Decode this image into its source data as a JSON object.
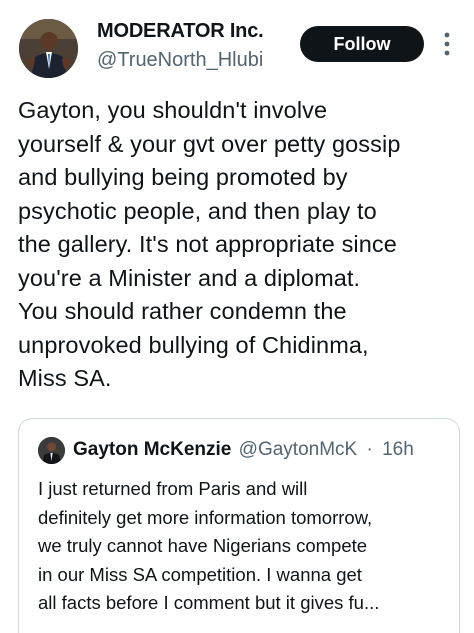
{
  "tweet": {
    "author": {
      "display_name": "MODERATOR Inc.",
      "handle": "@TrueNorth_Hlubi",
      "avatar_icon": "profile-photo"
    },
    "follow_label": "Follow",
    "more_icon": "vertical-ellipsis-icon",
    "body_lines": [
      "Gayton, you shouldn't involve",
      "yourself & your gvt over petty gossip",
      "and bullying being promoted by",
      "psychotic people, and then play to",
      "the gallery. It's not appropriate since",
      "you're a Minister and a diplomat.",
      "You should rather condemn the",
      "unprovoked bullying of Chidinma,",
      "Miss SA."
    ]
  },
  "quoted_tweet": {
    "author": {
      "display_name": "Gayton McKenzie",
      "handle": "@GaytonMcK",
      "separator": "·",
      "timestamp": "16h",
      "avatar_icon": "profile-photo"
    },
    "body_lines": [
      "I just returned from Paris and will",
      "definitely get more information tomorrow,",
      "we truly cannot have Nigerians compete",
      "in our Miss SA competition. I wanna get",
      "all facts before I comment but it gives fu..."
    ]
  },
  "colors": {
    "primary_text": "#0f1419",
    "secondary_text": "#536471",
    "follow_button_bg": "#0f1419",
    "border": "#cfd9de"
  }
}
